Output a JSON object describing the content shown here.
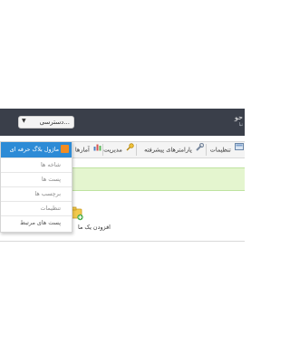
{
  "topbar": {
    "brand_line1": "حو",
    "brand_line2": "تبا"
  },
  "access_dropdown": {
    "value": "دسترسی..."
  },
  "navbar": {
    "items": [
      {
        "label": "تنظیمات",
        "icon": "settings-icon"
      },
      {
        "label": "پارامترهای پیشرفته",
        "icon": "wrench-icon"
      },
      {
        "label": "مدیریت",
        "icon": "key-icon"
      },
      {
        "label": "آمارها",
        "icon": "bar-chart-icon"
      }
    ]
  },
  "blog_menu": {
    "header": "ماژول بلاگ حرفه ای",
    "items": [
      "شاخه ها",
      "پست ها",
      "برچسب ها",
      "تنظیمات",
      "پست های مرتبط"
    ]
  },
  "quick_add": {
    "label": "افزودن یک ما"
  }
}
